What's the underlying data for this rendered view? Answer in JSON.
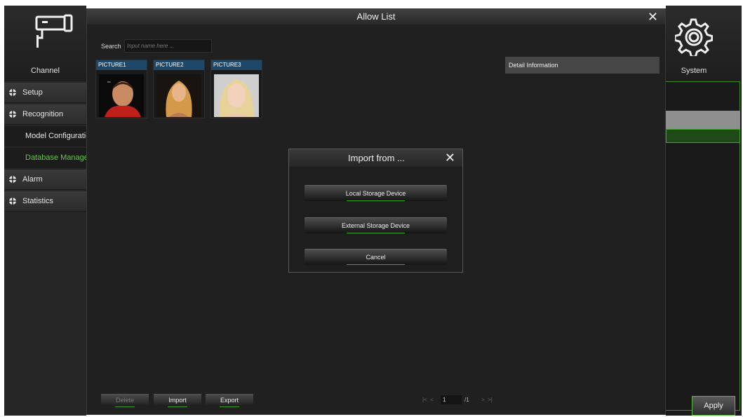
{
  "sidebar_left": {
    "channel_label": "Channel",
    "items": [
      {
        "label": "Setup"
      },
      {
        "label": "Recognition"
      },
      {
        "label": "Model Configuration"
      },
      {
        "label": "Database Management"
      },
      {
        "label": "Alarm"
      },
      {
        "label": "Statistics"
      }
    ]
  },
  "sidebar_right": {
    "system_label": "System",
    "apply_label": "Apply"
  },
  "dialog": {
    "title": "Allow List",
    "close_icon": "close-icon",
    "search": {
      "label": "Search",
      "placeholder": "Input name here ..."
    },
    "pictures": [
      {
        "label": "PICTURE1"
      },
      {
        "label": "PICTURE2"
      },
      {
        "label": "PICTURE3"
      }
    ],
    "detail_header": "Detail Information",
    "buttons": {
      "delete": "Delete",
      "import": "Import",
      "export": "Export"
    },
    "pager": {
      "first": "|<",
      "prev": "<",
      "current": "1",
      "total": "/1",
      "next": ">",
      "last": ">|"
    }
  },
  "import_modal": {
    "title": "Import from ...",
    "options": [
      "Local Storage Device",
      "External Storage Device",
      "Cancel"
    ]
  },
  "colors": {
    "accent_green": "#5bbb3d",
    "picture_header": "#1f4768"
  }
}
